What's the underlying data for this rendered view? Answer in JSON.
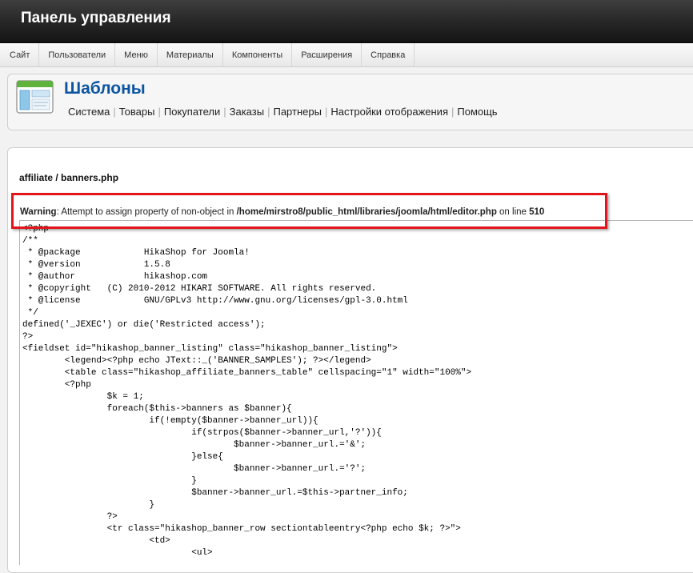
{
  "header": {
    "title": "Панель управления"
  },
  "menu": {
    "items": [
      "Сайт",
      "Пользователи",
      "Меню",
      "Материалы",
      "Компоненты",
      "Расширения",
      "Справка"
    ]
  },
  "toolbar": {
    "icon": "templates-icon",
    "title": "Шаблоны",
    "submenu": [
      "Система",
      "Товары",
      "Покупатели",
      "Заказы",
      "Партнеры",
      "Настройки отображения",
      "Помощь"
    ]
  },
  "content": {
    "file_path": "affiliate / banners.php",
    "warning": {
      "label": "Warning",
      "message": ": Attempt to assign property of non-object in ",
      "path": "/home/mirstro8/public_html/libraries/joomla/html/editor.php",
      "line_text": " on line ",
      "line_number": "510"
    },
    "code_lines": [
      "<?php",
      "/**",
      " * @package            HikaShop for Joomla!",
      " * @version            1.5.8",
      " * @author             hikashop.com",
      " * @copyright   (C) 2010-2012 HIKARI SOFTWARE. All rights reserved.",
      " * @license            GNU/GPLv3 http://www.gnu.org/licenses/gpl-3.0.html",
      " */",
      "defined('_JEXEC') or die('Restricted access');",
      "?>",
      "<fieldset id=\"hikashop_banner_listing\" class=\"hikashop_banner_listing\">",
      "        <legend><?php echo JText::_('BANNER_SAMPLES'); ?></legend>",
      "        <table class=\"hikashop_affiliate_banners_table\" cellspacing=\"1\" width=\"100%\">",
      "        <?php",
      "                $k = 1;",
      "                foreach($this->banners as $banner){",
      "                        if(!empty($banner->banner_url)){",
      "                                if(strpos($banner->banner_url,'?')){",
      "                                        $banner->banner_url.='&';",
      "                                }else{",
      "                                        $banner->banner_url.='?';",
      "                                }",
      "                                $banner->banner_url.=$this->partner_info;",
      "                        }",
      "                ?>",
      "                <tr class=\"hikashop_banner_row sectiontableentry<?php echo $k; ?>\">",
      "                        <td>",
      "                                <ul>"
    ]
  }
}
